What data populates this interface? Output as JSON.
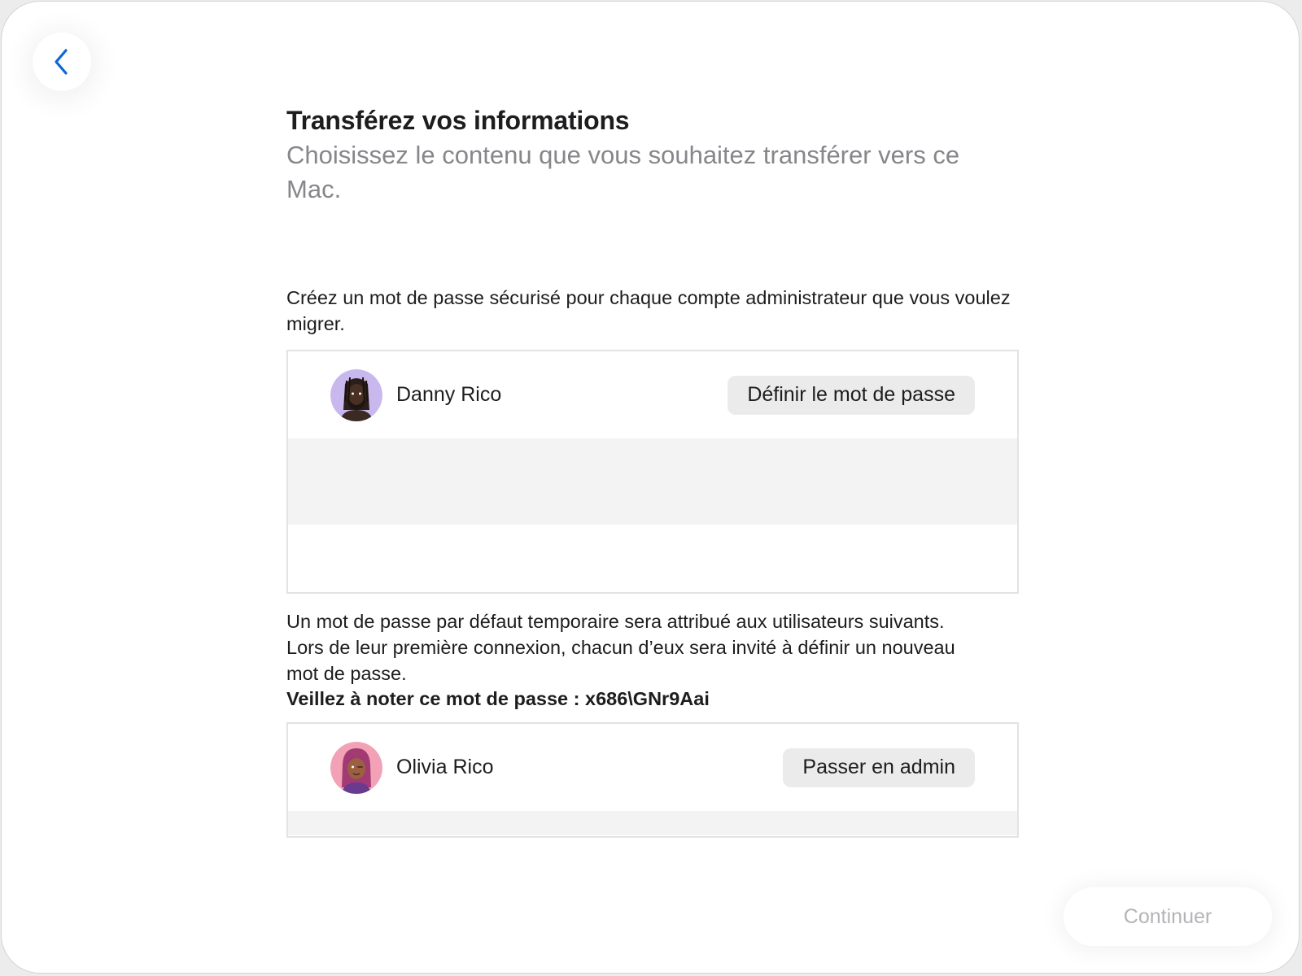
{
  "header": {
    "title": "Transférez vos informations",
    "subtitle": "Choisissez le contenu que vous souhaitez transférer vers ce Mac."
  },
  "admin_section": {
    "intro": "Créez un mot de passe sécurisé pour chaque compte administrateur que vous voulez migrer.",
    "users": [
      {
        "name": "Danny Rico",
        "action_label": "Définir le mot de passe"
      }
    ]
  },
  "standard_section": {
    "note": "Un mot de passe par défaut temporaire sera attribué aux utilisateurs suivants. Lors de leur première connexion, chacun d’eux sera invité à définir un nouveau mot de passe.",
    "password_note": "Veillez à noter ce mot de passe : x686\\GNr9Aai",
    "users": [
      {
        "name": "Olivia Rico",
        "action_label": "Passer en admin"
      }
    ]
  },
  "footer": {
    "continue_label": "Continuer"
  },
  "icons": {
    "back": "chevron-left-icon"
  },
  "colors": {
    "accent": "#0a67d6",
    "title_text": "#1d1d1f",
    "subtitle_text": "#86868b",
    "disabled_text": "#b4b4b8",
    "button_bg": "#ebebeb"
  }
}
